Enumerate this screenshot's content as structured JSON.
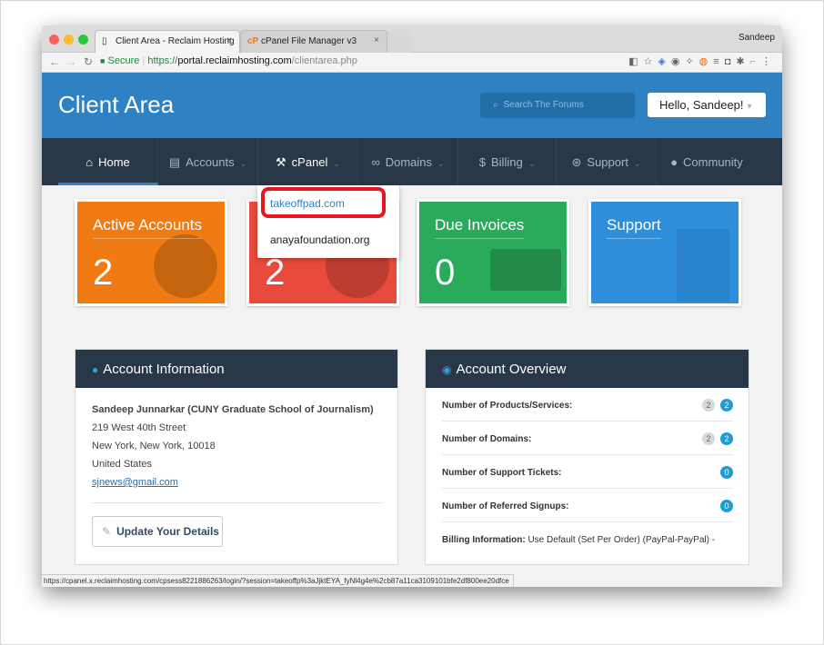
{
  "browser": {
    "tabs": [
      {
        "title": "Client Area - Reclaim Hosting",
        "icon": "page-icon"
      },
      {
        "title": "cPanel File Manager v3",
        "icon": "cpanel-icon"
      }
    ],
    "close_glyph": "×",
    "profile": "Sandeep",
    "secure_label": "Secure",
    "url_scheme": "https://",
    "url_domain": "portal.reclaimhosting.com",
    "url_path": "/clientarea.php",
    "status_url": "https://cpanel.x.reclaimhosting.com/cpsess8221886263/login/?session=takeoffp%3aJjktEYA_fyNl4g4e%2cb87a11ca3109101bfe2df800ee20dfce"
  },
  "header": {
    "brand": "Client Area",
    "search_placeholder": "Search The Forums",
    "hello": "Hello, Sandeep!"
  },
  "nav": {
    "items": [
      {
        "label": "Home",
        "icon": "home-icon"
      },
      {
        "label": "Accounts",
        "icon": "list-icon"
      },
      {
        "label": "cPanel",
        "icon": "wrench-icon"
      },
      {
        "label": "Domains",
        "icon": "binoculars-icon"
      },
      {
        "label": "Billing",
        "icon": "dollar-icon"
      },
      {
        "label": "Support",
        "icon": "lifebuoy-icon"
      },
      {
        "label": "Community",
        "icon": "user-icon"
      }
    ]
  },
  "cpanel_dropdown": [
    "takeoffpad.com",
    "anayafoundation.org"
  ],
  "tiles": [
    {
      "label": "Active Accounts",
      "value": "2",
      "color": "#f07b12"
    },
    {
      "label": "",
      "value": "2",
      "color": "#e84b3c"
    },
    {
      "label": "Due Invoices",
      "value": "0",
      "color": "#29ab5b"
    },
    {
      "label": "Support",
      "value": "",
      "color": "#2f8edb"
    }
  ],
  "account_info": {
    "title": "Account Information",
    "name": "Sandeep Junnarkar (CUNY Graduate School of Journalism)",
    "address1": "219 West 40th Street",
    "address2": "New York, New York, 10018",
    "country": "United States",
    "email": "sjnews@gmail.com",
    "update_button": "Update Your Details"
  },
  "overview": {
    "title": "Account Overview",
    "rows": [
      {
        "label": "Number of Products/Services:",
        "total": "2",
        "active": "2"
      },
      {
        "label": "Number of Domains:",
        "total": "2",
        "active": "2"
      },
      {
        "label": "Number of Support Tickets:",
        "total": "",
        "active": "0"
      },
      {
        "label": "Number of Referred Signups:",
        "total": "",
        "active": "0"
      }
    ],
    "billing_label": "Billing Information:",
    "billing_value": "Use Default (Set Per Order) (PayPal-PayPal) -"
  },
  "colors": {
    "header_blue": "#2e82c4",
    "nav_dark": "#283848",
    "highlight_red": "#e8141e"
  }
}
